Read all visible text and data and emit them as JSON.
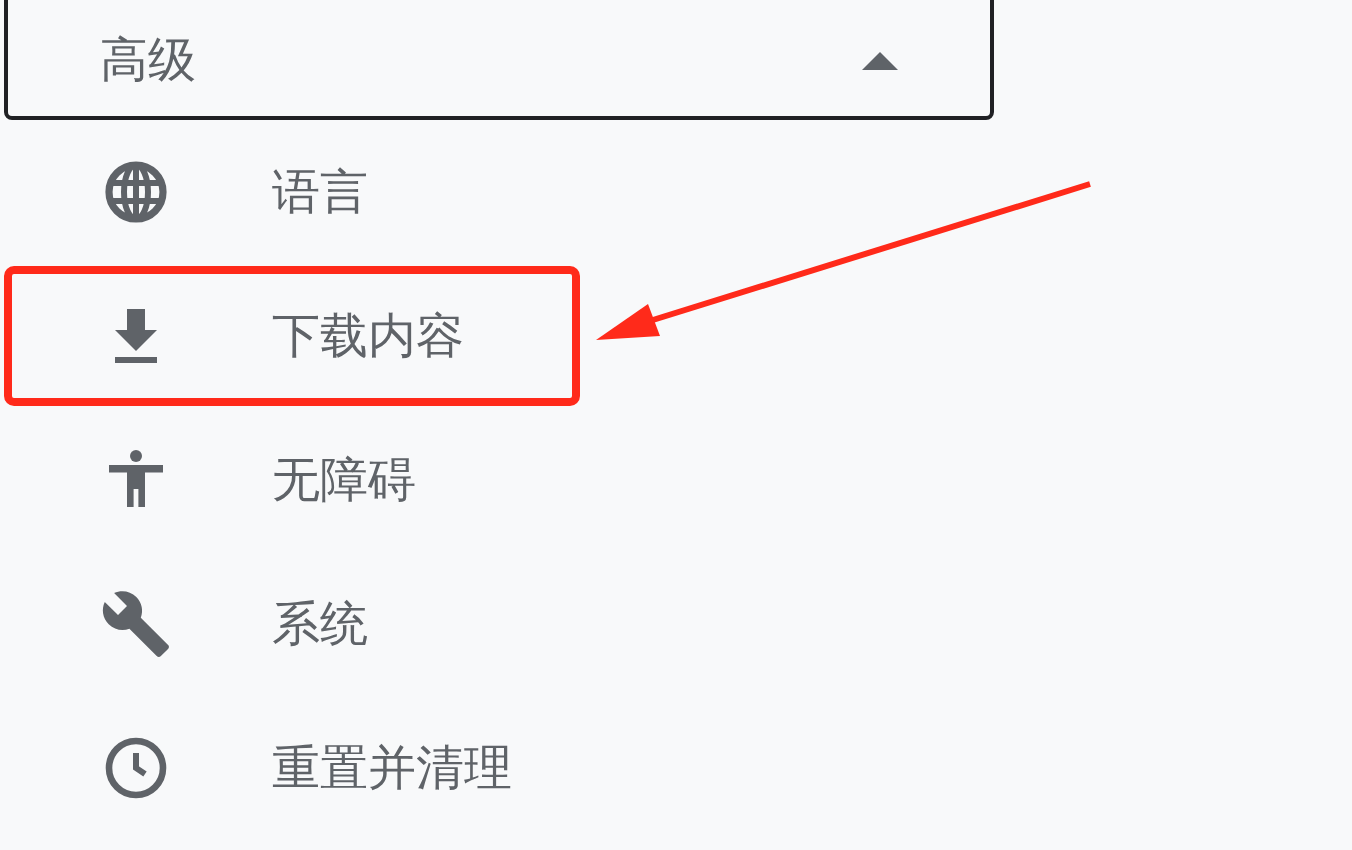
{
  "section": {
    "label": "高级",
    "expanded": true
  },
  "items": [
    {
      "label": "语言",
      "highlighted": false
    },
    {
      "label": "下载内容",
      "highlighted": true
    },
    {
      "label": "无障碍",
      "highlighted": false
    },
    {
      "label": "系统",
      "highlighted": false
    },
    {
      "label": "重置并清理",
      "highlighted": false
    }
  ]
}
